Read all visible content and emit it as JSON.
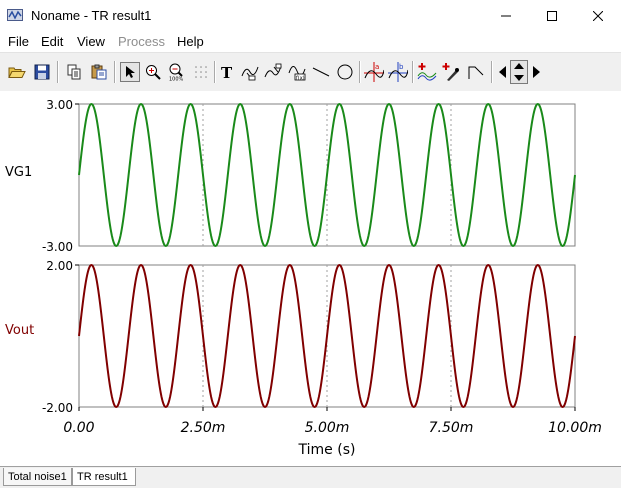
{
  "window": {
    "title": "Noname - TR result1"
  },
  "menu": [
    {
      "label": "File",
      "disabled": false
    },
    {
      "label": "Edit",
      "disabled": false
    },
    {
      "label": "View",
      "disabled": false
    },
    {
      "label": "Process",
      "disabled": true
    },
    {
      "label": "Help",
      "disabled": false
    }
  ],
  "toolbar": {
    "buttons": [
      "open-folder-icon",
      "save-icon",
      "copy-icon",
      "paste-icon",
      "select-arrow-icon",
      "zoom-in-icon",
      "zoom-100-icon",
      "grid-icon",
      "text-icon",
      "curve-label-icon",
      "curve-label-2-icon",
      "formula-label-icon",
      "line-icon",
      "circle-icon",
      "cursor-a-icon",
      "cursor-b-icon",
      "add-curve-icon",
      "add-marker-icon",
      "slope-icon",
      "move-left-icon",
      "move-up-down-icon",
      "move-right-icon"
    ]
  },
  "colors": {
    "vg1": "#1a8a1a",
    "vout": "#800000",
    "frame": "#808080",
    "grid": "#a0a0a0"
  },
  "chart_data": [
    {
      "type": "line",
      "ylabel": "VG1",
      "ylim": [
        -3.0,
        3.0
      ],
      "y_ticks": [
        "3.00",
        "-3.00"
      ],
      "xlim": [
        0,
        0.01
      ],
      "grid": "vertical dashed at 2.50m, 5.00m, 7.50m",
      "series": [
        {
          "name": "VG1",
          "waveform": "sine",
          "amplitude": 3.0,
          "period_s": 0.001,
          "phase_start": 0,
          "samples_x": [
            0,
            0.00025,
            0.0005,
            0.00075,
            0.001
          ],
          "samples_y": [
            0,
            3.0,
            0,
            -3.0,
            0
          ]
        }
      ]
    },
    {
      "type": "line",
      "ylabel": "Vout",
      "ylim": [
        -2.0,
        2.0
      ],
      "y_ticks": [
        "2.00",
        "-2.00"
      ],
      "xlabel": "Time (s)",
      "x_ticks": [
        "0.00",
        "2.50m",
        "5.00m",
        "7.50m",
        "10.00m"
      ],
      "xlim": [
        0,
        0.01
      ],
      "grid": "vertical dashed at 2.50m, 5.00m, 7.50m",
      "series": [
        {
          "name": "Vout",
          "waveform": "sine",
          "amplitude": 2.0,
          "period_s": 0.001,
          "phase_start": 0,
          "samples_x": [
            0,
            0.00025,
            0.0005,
            0.00075,
            0.001
          ],
          "samples_y": [
            0,
            2.0,
            0,
            -2.0,
            0
          ]
        }
      ]
    }
  ],
  "tabs": [
    {
      "label": "Total noise1",
      "active": false
    },
    {
      "label": "TR result1",
      "active": true
    }
  ]
}
